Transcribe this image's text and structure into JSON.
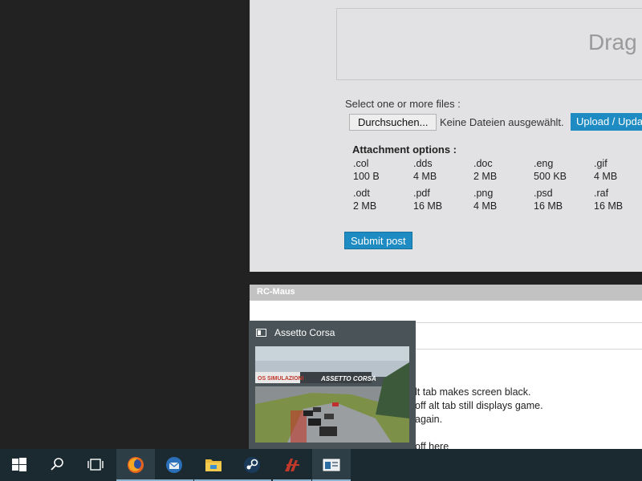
{
  "upload": {
    "drop_text": "Drag",
    "select_label": "Select one or more files :",
    "browse_label": "Durchsuchen...",
    "no_file_text": "Keine Dateien ausgewählt.",
    "upload_label": "Upload / Update",
    "attachment_heading": "Attachment options :",
    "attachments": [
      {
        "ext": ".col",
        "size": "100 B"
      },
      {
        "ext": ".dds",
        "size": "4 MB"
      },
      {
        "ext": ".doc",
        "size": "2 MB"
      },
      {
        "ext": ".eng",
        "size": "500 KB"
      },
      {
        "ext": ".gif",
        "size": "4 MB"
      },
      {
        "ext": ".odt",
        "size": "2 MB"
      },
      {
        "ext": ".pdf",
        "size": "16 MB"
      },
      {
        "ext": ".png",
        "size": "4 MB"
      },
      {
        "ext": ".psd",
        "size": "16 MB"
      },
      {
        "ext": ".raf",
        "size": "16 MB"
      }
    ],
    "submit_label": "Submit post"
  },
  "forum": {
    "title": "RC-Maus",
    "lines": [
      "lt tab makes screen black.",
      "off alt tab still displays game.",
      "again.",
      "off here"
    ]
  },
  "thumbnail": {
    "title": "Assetto Corsa",
    "banner_left": "OS SIMULAZIONI",
    "banner_right": "ASSETTO CORSA"
  },
  "taskbar": {
    "items": [
      "start-icon",
      "search-icon",
      "task-view-icon",
      "firefox-icon",
      "thunderbird-icon",
      "file-explorer-icon",
      "steam-icon",
      "assetto-corsa-icon",
      "app-window-icon"
    ],
    "accent_color": "#1e8bc3",
    "taskbar_color": "#1b2a30"
  }
}
